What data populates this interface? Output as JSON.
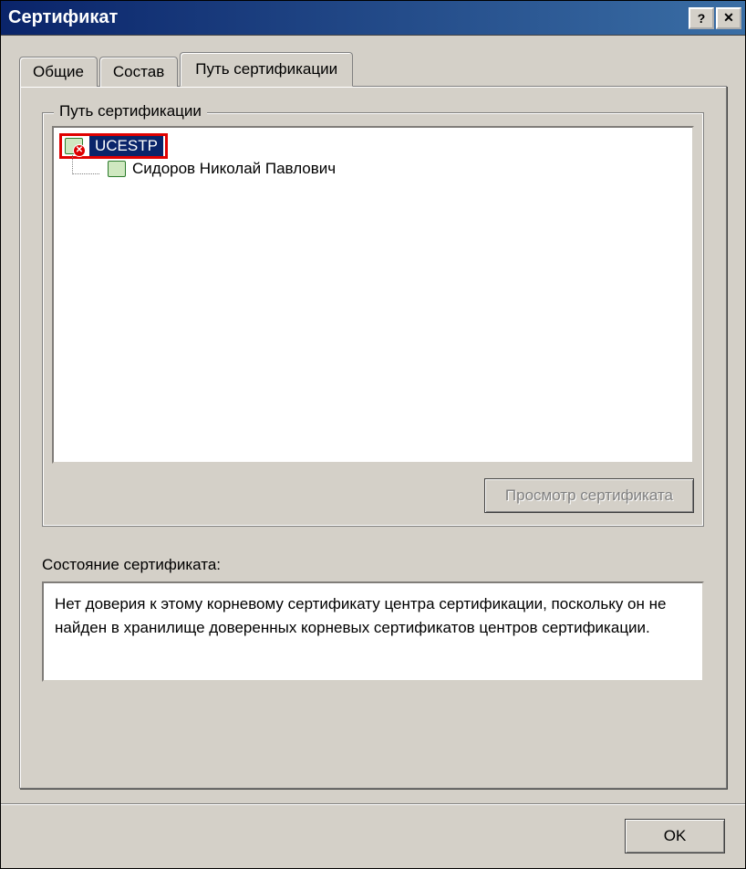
{
  "window": {
    "title": "Сертификат",
    "help_btn": "?",
    "close_btn": "✕"
  },
  "tabs": {
    "general": "Общие",
    "details": "Состав",
    "path": "Путь сертификации"
  },
  "path_group": {
    "legend": "Путь сертификации",
    "root_cert": "UCESTP",
    "child_cert": "Сидоров Николай Павлович"
  },
  "buttons": {
    "view_cert": "Просмотр сертификата",
    "ok": "OK"
  },
  "status": {
    "label": "Состояние сертификата:",
    "text": "Нет доверия к этому корневому сертификату центра сертификации, поскольку он не найден в хранилище доверенных корневых сертификатов центров сертификации."
  }
}
